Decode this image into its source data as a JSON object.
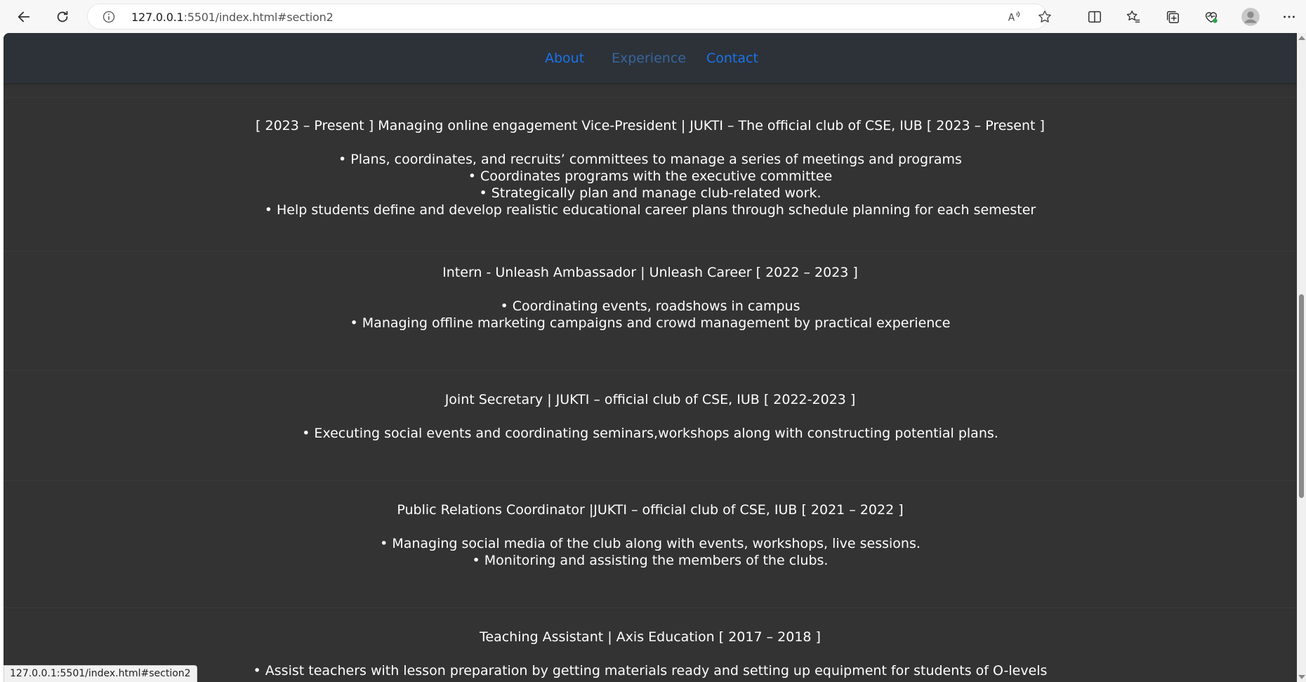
{
  "browser": {
    "url_host": "127.0.0.1",
    "url_rest": ":5501/index.html#section2",
    "status_url": "127.0.0.1:5501/index.html#section2",
    "icons": [
      "back-icon",
      "refresh-icon",
      "info-icon",
      "read-aloud-icon",
      "favorite-star-icon",
      "split-screen-icon",
      "favorites-icon",
      "collections-icon",
      "browser-essentials-icon",
      "profile-avatar-icon",
      "more-icon"
    ]
  },
  "nav": {
    "about": "About",
    "experience": "Experience",
    "contact": "Contact"
  },
  "experience": [
    {
      "title": "[ 2023 – Present ] Managing online engagement Vice-President | JUKTI – The official club of CSE, IUB [ 2023 – Present ]",
      "bullets": [
        "• Plans, coordinates, and recruits’ committees to manage a series of meetings and programs",
        "• Coordinates programs with the executive committee",
        "• Strategically plan and manage club-related work.",
        "• Help students define and develop realistic educational career plans through schedule planning for each semester"
      ]
    },
    {
      "title": "Intern - Unleash Ambassador | Unleash Career [ 2022 – 2023 ]",
      "bullets": [
        "• Coordinating events, roadshows in campus",
        "• Managing offline marketing campaigns and crowd management by practical experience"
      ]
    },
    {
      "title": "Joint Secretary | JUKTI – official club of CSE, IUB [ 2022-2023 ]",
      "bullets": [
        "• Executing social events and coordinating seminars,workshops along with constructing potential plans."
      ]
    },
    {
      "title": "Public Relations Coordinator |JUKTI – official club of CSE, IUB [ 2021 – 2022 ]",
      "bullets": [
        "• Managing social media of the club along with events, workshops, live sessions.",
        "• Monitoring and assisting the members of the clubs."
      ]
    },
    {
      "title": "Teaching Assistant | Axis Education [ 2017 – 2018 ]",
      "bullets": [
        "• Assist teachers with lesson preparation by getting materials ready and setting up equipment for students of O-levels"
      ]
    }
  ],
  "colors": {
    "page_bg": "#333333",
    "navbar_bg": "#2d3239",
    "link": "#1a73e8",
    "text": "#ffffff"
  }
}
